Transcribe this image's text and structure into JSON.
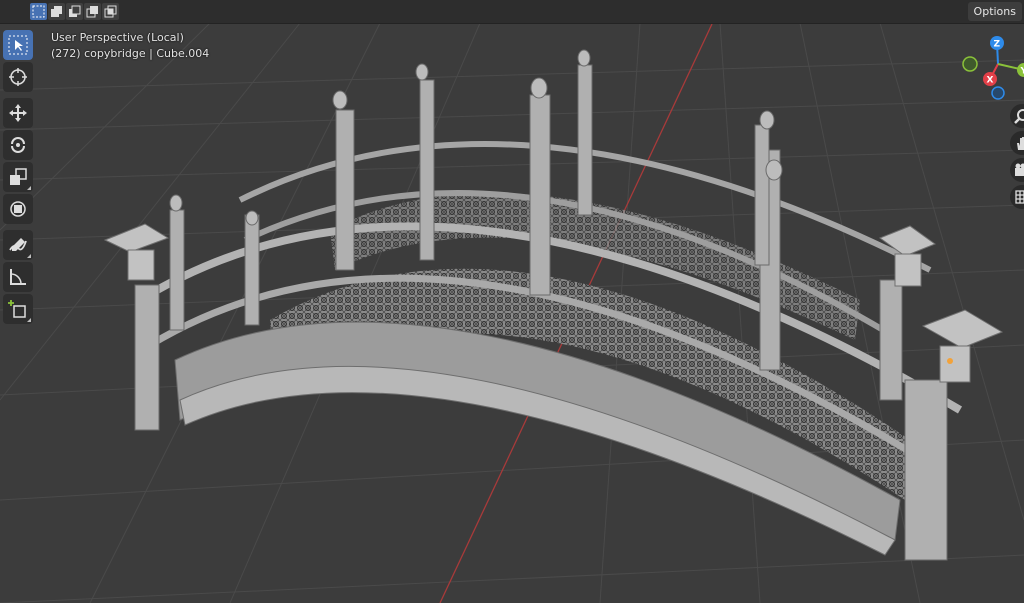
{
  "header": {
    "modes": [
      {
        "name": "select-new-mode-button",
        "active": true
      },
      {
        "name": "select-extend-mode-button",
        "active": false
      },
      {
        "name": "select-subtract-mode-button",
        "active": false
      },
      {
        "name": "select-invert-mode-button",
        "active": false
      },
      {
        "name": "select-intersect-mode-button",
        "active": false
      }
    ],
    "options_label": "Options"
  },
  "viewport": {
    "perspective_label": "User Perspective (Local)",
    "object_info": "(272) copybridge | Cube.004"
  },
  "toolbar": {
    "tools": [
      {
        "icon": "select-box-icon",
        "active": true
      },
      {
        "icon": "cursor-icon",
        "active": false
      },
      {
        "icon": "move-icon",
        "active": false
      },
      {
        "icon": "rotate-icon",
        "active": false
      },
      {
        "icon": "scale-icon",
        "active": false
      },
      {
        "icon": "transform-icon",
        "active": false
      },
      {
        "icon": "annotate-icon",
        "active": false
      },
      {
        "icon": "measure-icon",
        "active": false
      },
      {
        "icon": "add-cube-icon",
        "active": false
      }
    ]
  },
  "gizmo": {
    "z_label": "Z",
    "x_label": "X",
    "y_label": "Y",
    "colors": {
      "x": "#e33f48",
      "y": "#8bc23a",
      "z": "#2e8bea"
    }
  },
  "nav": {
    "buttons": [
      "zoom-icon",
      "pan-hand-icon",
      "camera-icon",
      "grid-icon"
    ]
  },
  "theme": {
    "viewport_bg": "#3c3c3c",
    "accent": "#4772b3",
    "x_axis_line": "#a83a3a"
  }
}
